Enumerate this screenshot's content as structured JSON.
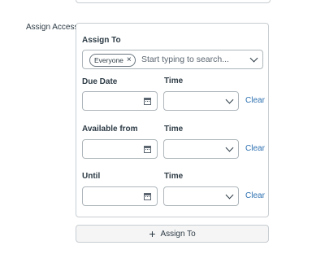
{
  "section_label": "Assign Access",
  "assign_to": {
    "label": "Assign To",
    "chip": "Everyone",
    "chip_remove_icon": "close-icon",
    "placeholder": "Start typing to search..."
  },
  "rows": [
    {
      "date_label": "Due Date",
      "time_label": "Time",
      "clear": "Clear"
    },
    {
      "date_label": "Available from",
      "time_label": "Time",
      "clear": "Clear"
    },
    {
      "date_label": "Until",
      "time_label": "Time",
      "clear": "Clear"
    }
  ],
  "add_button": {
    "label": "Assign To",
    "icon": "plus-icon"
  },
  "colors": {
    "link": "#2b6fb0",
    "border": "#aeb6bb",
    "text": "#2d3b45"
  }
}
